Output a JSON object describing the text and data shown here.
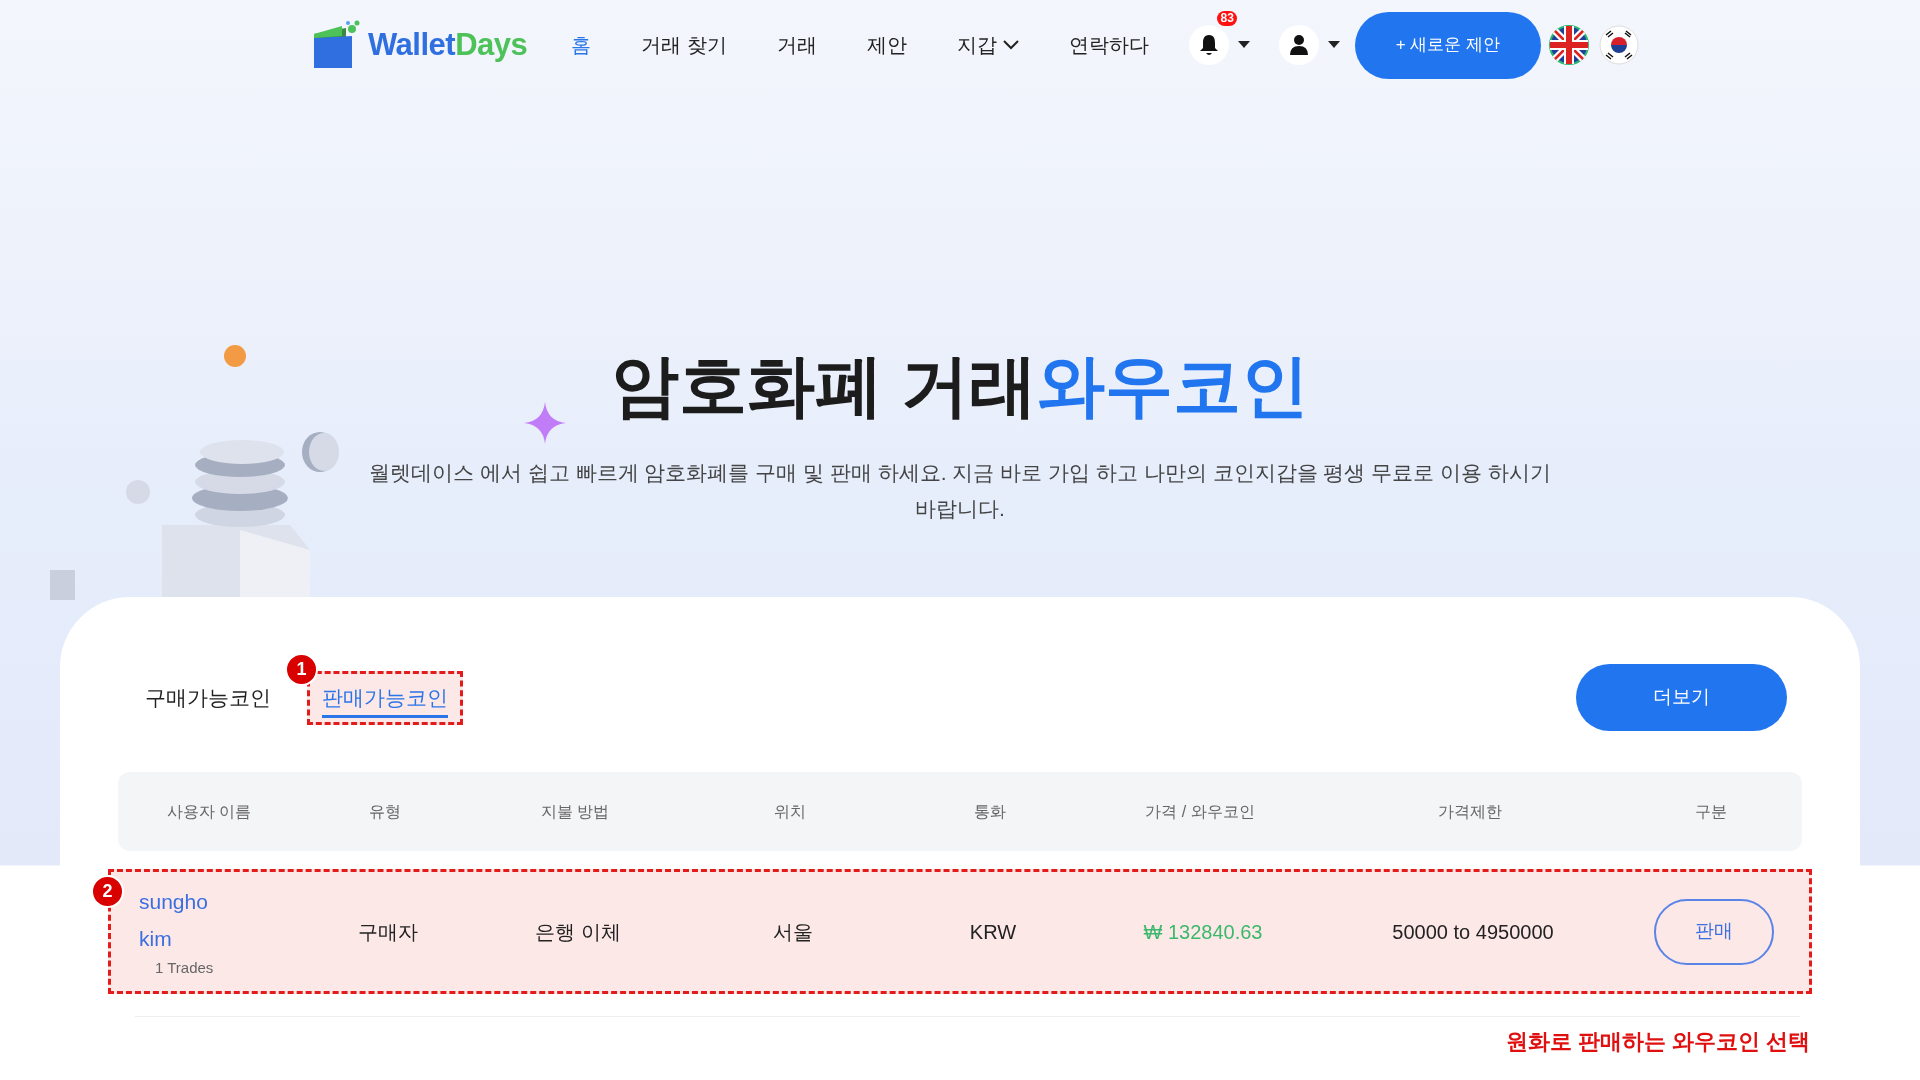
{
  "nav": {
    "logo": [
      "Wallet",
      "Days"
    ],
    "items": [
      {
        "label": "홈",
        "selected": true,
        "dropdown": false
      },
      {
        "label": "거래 찾기",
        "selected": false,
        "dropdown": false
      },
      {
        "label": "거래",
        "selected": false,
        "dropdown": false
      },
      {
        "label": "제안",
        "selected": false,
        "dropdown": false
      },
      {
        "label": "지갑",
        "selected": false,
        "dropdown": true
      },
      {
        "label": "연락하다",
        "selected": false,
        "dropdown": false
      }
    ],
    "notification_count": "83",
    "new_offer_button": "+ 새로운 제안",
    "languages": [
      {
        "kind": "uk"
      },
      {
        "kind": "kr"
      }
    ]
  },
  "hero": {
    "title": [
      {
        "text": "암호화폐 거래",
        "highlight": false
      },
      {
        "text": "와우코인",
        "highlight": true
      }
    ],
    "subtitle": "월렛데이스 에서 쉽고 빠르게 암호화폐를 구매 및 판매 하세요. 지금 바로 가입 하고 나만의 코인지갑을 평생 무료로 이용 하시기 바랍니다."
  },
  "tabs": [
    {
      "label": "구매가능코인",
      "selected": false
    },
    {
      "label": "판매가능코인",
      "selected": true,
      "annotation": "1"
    }
  ],
  "more_button": "더보기",
  "table": {
    "columns": [
      "사용자 이름",
      "유형",
      "지불 방법",
      "위치",
      "통화",
      "가격 / 와우코인",
      "가격제한",
      "구분"
    ],
    "rows": [
      {
        "username": "sungho kim",
        "trades": "1 Trades",
        "type": "구매자",
        "payment": "은행 이체",
        "location": "서울",
        "currency": "KRW",
        "price": "₩ 132840.63",
        "limit": "50000 to 4950000",
        "action": "판매",
        "annotation": "2"
      }
    ]
  },
  "annotation_caption": "원화로 판매하는 와우코인 선택"
}
